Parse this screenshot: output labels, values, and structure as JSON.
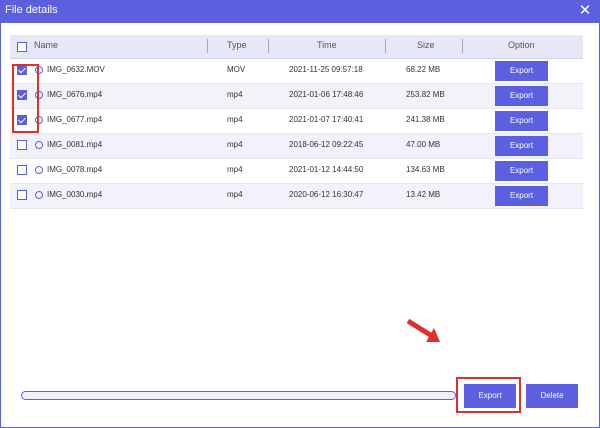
{
  "window": {
    "title": "File details"
  },
  "table": {
    "headers": {
      "name": "Name",
      "type": "Type",
      "time": "Time",
      "size": "Size",
      "option": "Option"
    },
    "rows": [
      {
        "checked": true,
        "name": "IMG_0632.MOV",
        "type": "MOV",
        "time": "2021-11-25 09:57:18",
        "size": "68.22 MB",
        "action": "Export"
      },
      {
        "checked": true,
        "name": "IMG_0676.mp4",
        "type": "mp4",
        "time": "2021-01-06 17:48:46",
        "size": "253.82 MB",
        "action": "Export"
      },
      {
        "checked": true,
        "name": "IMG_0677.mp4",
        "type": "mp4",
        "time": "2021-01-07 17:40:41",
        "size": "241.38 MB",
        "action": "Export"
      },
      {
        "checked": false,
        "name": "IMG_0081.mp4",
        "type": "mp4",
        "time": "2018-06-12 09:22:45",
        "size": "47.00 MB",
        "action": "Export"
      },
      {
        "checked": false,
        "name": "IMG_0078.mp4",
        "type": "mp4",
        "time": "2021-01-12 14:44:50",
        "size": "134.63 MB",
        "action": "Export"
      },
      {
        "checked": false,
        "name": "IMG_0030.mp4",
        "type": "mp4",
        "time": "2020-06-12 16:30:47",
        "size": "13.42 MB",
        "action": "Export"
      }
    ]
  },
  "progress": {
    "value": 0
  },
  "footer": {
    "export_label": "Export",
    "delete_label": "Delete"
  },
  "colors": {
    "accent": "#5b5fe0",
    "highlight": "#e0302a"
  }
}
